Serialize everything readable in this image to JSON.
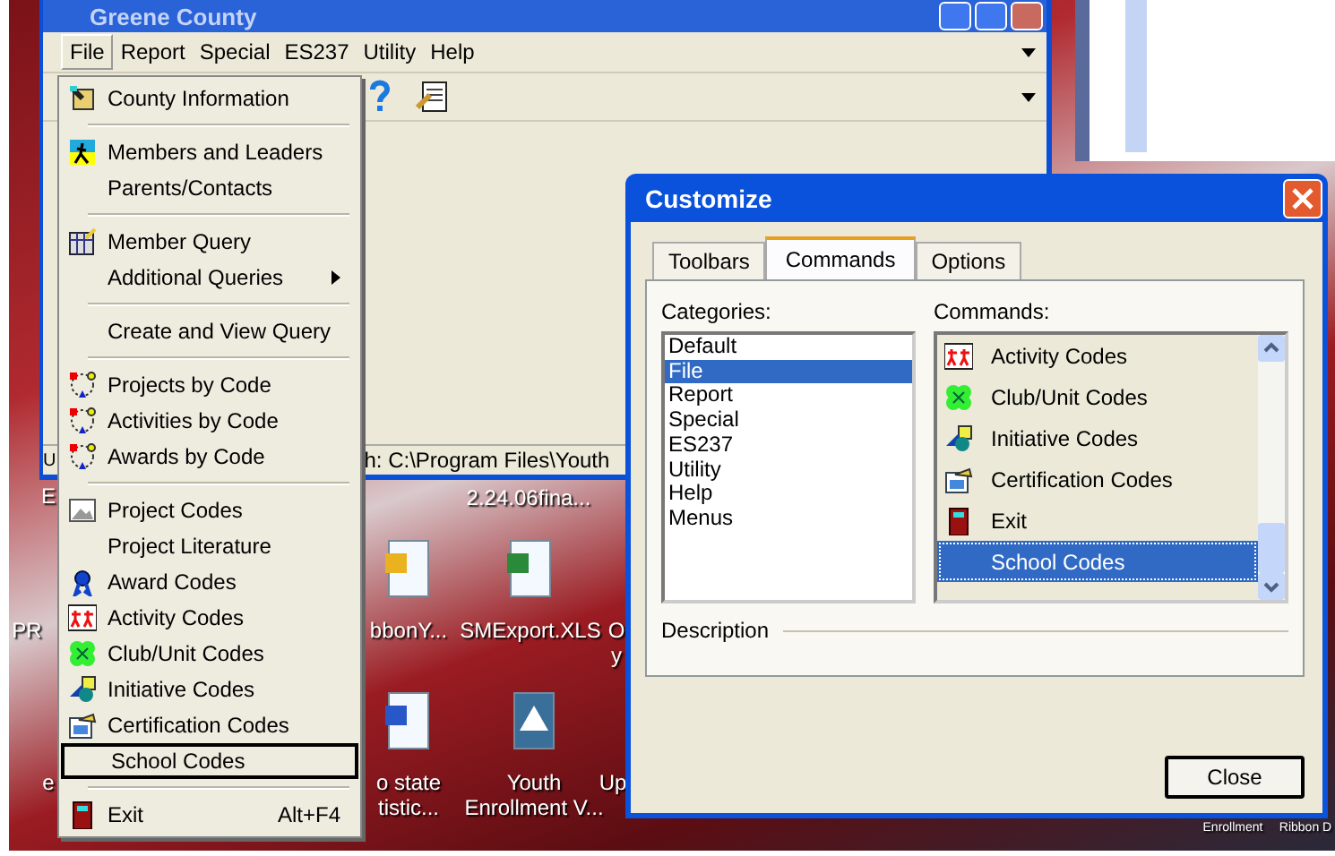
{
  "app_window": {
    "title": "Greene County",
    "menus": [
      {
        "label": "File",
        "selected": true
      },
      {
        "label": "Report",
        "selected": false
      },
      {
        "label": "Special",
        "selected": false
      },
      {
        "label": "ES237",
        "selected": false
      },
      {
        "label": "Utility",
        "selected": false
      },
      {
        "label": "Help",
        "selected": false
      }
    ],
    "status_left": "U",
    "status_text": "h:  C:\\Program Files\\Youth"
  },
  "file_menu": [
    {
      "kind": "item",
      "label": "County Information",
      "selected": false
    },
    {
      "kind": "separator"
    },
    {
      "kind": "item",
      "label": "Members and Leaders",
      "selected": false
    },
    {
      "kind": "item",
      "label": "Parents/Contacts",
      "selected": false
    },
    {
      "kind": "separator"
    },
    {
      "kind": "item",
      "label": "Member Query",
      "selected": false
    },
    {
      "kind": "item",
      "label": "Additional Queries",
      "selected": false,
      "submenu": true
    },
    {
      "kind": "separator"
    },
    {
      "kind": "item",
      "label": "Create and View Query",
      "selected": false
    },
    {
      "kind": "separator"
    },
    {
      "kind": "item",
      "label": "Projects by Code",
      "selected": false
    },
    {
      "kind": "item",
      "label": "Activities by Code",
      "selected": false
    },
    {
      "kind": "item",
      "label": "Awards by Code",
      "selected": false
    },
    {
      "kind": "separator"
    },
    {
      "kind": "item",
      "label": "Project Codes",
      "selected": false
    },
    {
      "kind": "item",
      "label": "Project Literature",
      "selected": false
    },
    {
      "kind": "item",
      "label": "Award Codes",
      "selected": false
    },
    {
      "kind": "item",
      "label": "Activity Codes",
      "selected": false
    },
    {
      "kind": "item",
      "label": "Club/Unit Codes",
      "selected": false
    },
    {
      "kind": "item",
      "label": "Initiative Codes",
      "selected": false
    },
    {
      "kind": "item",
      "label": "Certification Codes",
      "selected": false
    },
    {
      "kind": "item",
      "label": "School Codes",
      "selected": true
    },
    {
      "kind": "separator"
    },
    {
      "kind": "item",
      "label": "Exit",
      "selected": false,
      "shortcut": "Alt+F4"
    }
  ],
  "desktop_icons": [
    {
      "lines": [
        "E"
      ]
    },
    {
      "lines": [
        "2.24.06fina..."
      ]
    },
    {
      "lines": [
        "PR"
      ]
    },
    {
      "lines": [
        "bbonY..."
      ]
    },
    {
      "lines": [
        "SMExport.XLS"
      ]
    },
    {
      "lines": [
        "O",
        "y"
      ]
    },
    {
      "lines": [
        "e"
      ]
    },
    {
      "lines": [
        "o state",
        "tistic..."
      ]
    },
    {
      "lines": [
        "Youth",
        "Enrollment V..."
      ]
    },
    {
      "lines": [
        "Up"
      ]
    },
    {
      "lines": [
        "Enrollment"
      ]
    },
    {
      "lines": [
        "Ribbon D"
      ]
    }
  ],
  "dialog": {
    "title": "Customize",
    "tabs": [
      {
        "label": "Toolbars",
        "selected": false
      },
      {
        "label": "Commands",
        "selected": true
      },
      {
        "label": "Options",
        "selected": false
      }
    ],
    "categories_label": "Categories:",
    "categories": [
      {
        "label": "Default",
        "selected": false
      },
      {
        "label": "File",
        "selected": true
      },
      {
        "label": "Report",
        "selected": false
      },
      {
        "label": "Special",
        "selected": false
      },
      {
        "label": "ES237",
        "selected": false
      },
      {
        "label": "Utility",
        "selected": false
      },
      {
        "label": "Help",
        "selected": false
      },
      {
        "label": "Menus",
        "selected": false
      }
    ],
    "commands_label": "Commands:",
    "commands": [
      {
        "label": "Activity Codes",
        "selected": false
      },
      {
        "label": "Club/Unit Codes",
        "selected": false
      },
      {
        "label": "Initiative Codes",
        "selected": false
      },
      {
        "label": "Certification Codes",
        "selected": false
      },
      {
        "label": "Exit",
        "selected": false
      },
      {
        "label": "School Codes",
        "selected": true
      }
    ],
    "description_label": "Description",
    "close_button": "Close"
  }
}
